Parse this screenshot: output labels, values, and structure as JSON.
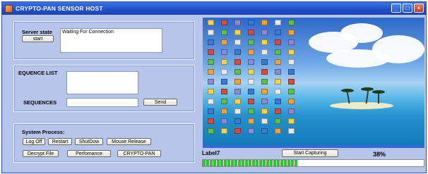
{
  "window": {
    "title": "CRYPTO-PAN SENSOR HOST",
    "controls": {
      "minimize": "_",
      "maximize": "□",
      "close": "×"
    }
  },
  "server_state": {
    "label": "Server state",
    "start_button": "start",
    "status_text": "Waiting For Connection"
  },
  "sequence": {
    "list_label": "EQUENCE LIST",
    "sequences_label": "SEQUENCES",
    "send_button": "Send"
  },
  "system_process": {
    "label": "System Process:",
    "row1": [
      "Log Off",
      "Restart",
      "ShutDow",
      "Mouse Release"
    ],
    "row2": [
      "Decrypt File",
      "Perfomance",
      "CRYPTO-PAN"
    ]
  },
  "capture": {
    "label": "Label7",
    "start_button": "Start Capturing",
    "percent_text": "38%",
    "progress": 0.43
  },
  "colors": {
    "window_bg": "#b8c5ea",
    "titlebar": "#1f4fc7",
    "progress_fill": "#33c233"
  },
  "icons": [
    "app-icon",
    "minimize-icon",
    "maximize-icon",
    "close-icon"
  ]
}
